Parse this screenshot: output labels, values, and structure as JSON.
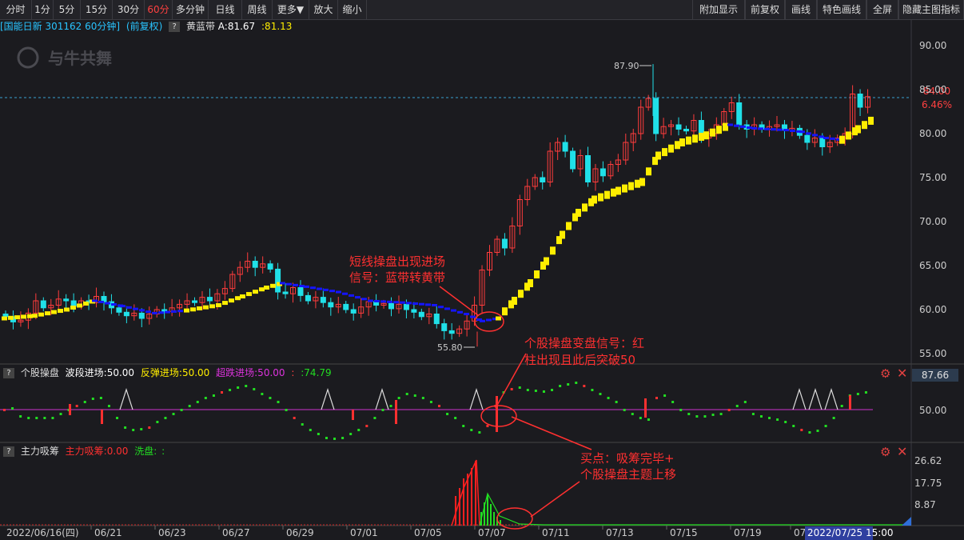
{
  "toolbar": {
    "left": [
      "分时",
      "1分",
      "5分",
      "15分",
      "30分",
      "60分",
      "多分钟",
      "日线",
      "周线",
      "更多▼",
      "放大",
      "缩小"
    ],
    "right": [
      "附加显示",
      "前复权",
      "画线",
      "特色画线",
      "全屏",
      "隐藏主图指标"
    ],
    "active": "60分"
  },
  "main_panel": {
    "stock_label": "[国能日新 301162 60分钟]",
    "adjust_label": "(前复权)",
    "indicator_name": "黄蓝带",
    "indicator_a": "A:81.67",
    "indicator_b": ":81.13",
    "watermark": "与牛共舞",
    "high_label": "87.90",
    "low_label": "55.80",
    "price_tag": "84.00",
    "pct_tag": "6.46%",
    "y_ticks": [
      "90.00",
      "85.00",
      "80.00",
      "75.00",
      "70.00",
      "65.00",
      "60.00",
      "55.00"
    ],
    "annotation": [
      "短线操盘出现进场",
      "信号：蓝带转黄带"
    ]
  },
  "sub_panel1": {
    "name": "个股操盘",
    "label1": "波段进场:50.00",
    "label2": "反弹进场:50.00",
    "label3": "超跌进场:50.00",
    "label4": ":",
    "label5": ":74.79",
    "value_tag": "87.66",
    "y_tick": "50.00",
    "annotation": [
      "个股操盘变盘信号：红",
      "柱出现且此后突破50"
    ]
  },
  "sub_panel2": {
    "name": "主力吸筹",
    "label1": "主力吸筹:0.00",
    "label2": "洗盘:",
    "label3": ":",
    "y_ticks": [
      "26.62",
      "17.75",
      "8.87"
    ],
    "annotation": [
      "买点：吸筹完毕+",
      "个股操盘主题上移"
    ]
  },
  "x_axis": {
    "labels": [
      "2022/06/16(四)",
      "06/21",
      "06/23",
      "06/27",
      "06/29",
      "07/01",
      "07/05",
      "07/07",
      "07/11",
      "07/13",
      "07/15",
      "07/19",
      "07/2"
    ],
    "cursor_label": "2022/07/25 15:00"
  },
  "colors": {
    "up": "#ff3c3c",
    "down": "#20e0e8",
    "yellow_band": "#ffee00",
    "blue_band": "#1515ff",
    "green": "#22dd22",
    "magenta": "#dd33dd"
  }
}
